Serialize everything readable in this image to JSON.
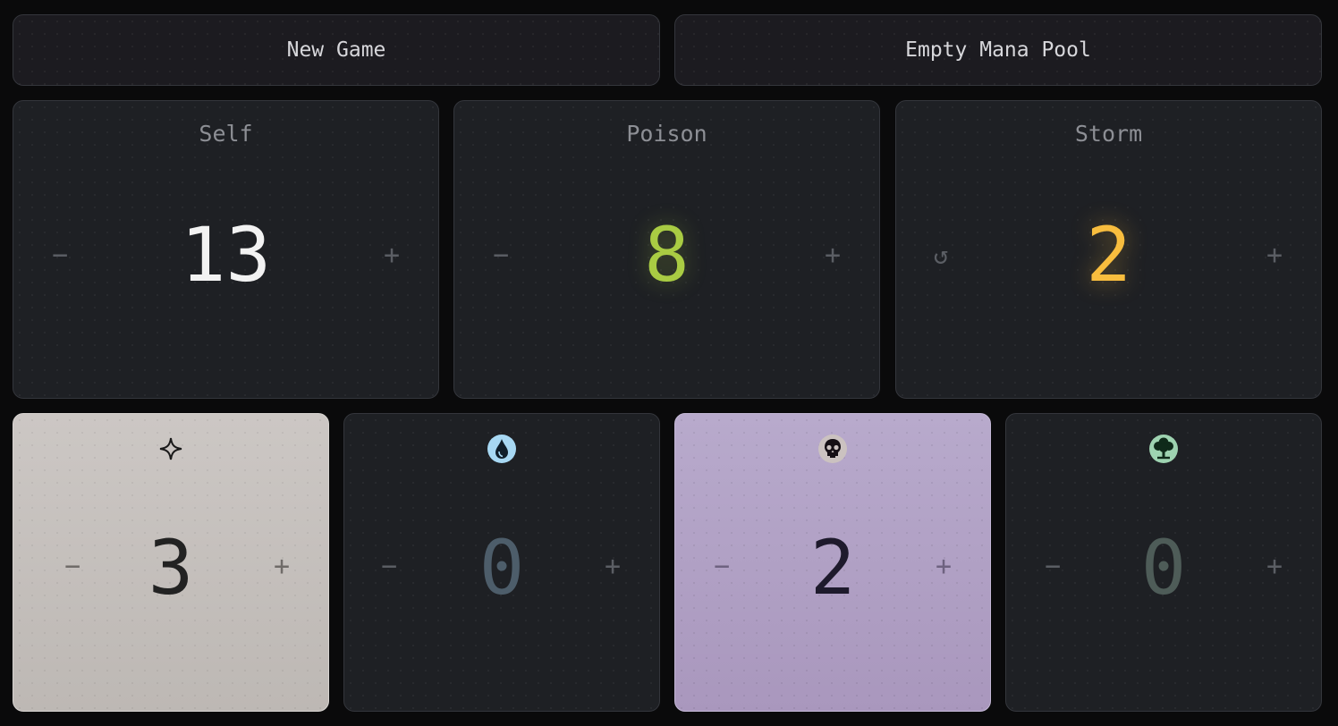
{
  "top_buttons": {
    "new_game": "New Game",
    "empty_mana_pool": "Empty Mana Pool"
  },
  "counters": {
    "self": {
      "label": "Self",
      "value": "13",
      "minus": "−",
      "plus": "+",
      "color": "#f2f2f2"
    },
    "poison": {
      "label": "Poison",
      "value": "8",
      "minus": "−",
      "plus": "+",
      "color": "#a9cc43"
    },
    "storm": {
      "label": "Storm",
      "value": "2",
      "reset": "↺",
      "plus": "+",
      "color": "#f8bd3e"
    }
  },
  "mana": {
    "white": {
      "icon": "white-mana-icon",
      "value": "3",
      "minus": "−",
      "plus": "+",
      "bg": "#c9c4c1",
      "color": "#222222"
    },
    "blue": {
      "icon": "blue-mana-icon",
      "value": "0",
      "minus": "−",
      "plus": "+",
      "bg": "#1e2024",
      "color": "#4d5d6a"
    },
    "black": {
      "icon": "black-mana-icon",
      "value": "2",
      "minus": "−",
      "plus": "+",
      "bg": "#b3a5c8",
      "color": "#1e1a2c"
    },
    "green": {
      "icon": "green-mana-icon",
      "value": "0",
      "minus": "−",
      "plus": "+",
      "bg": "#1e2024",
      "color": "#4e5c58"
    }
  }
}
